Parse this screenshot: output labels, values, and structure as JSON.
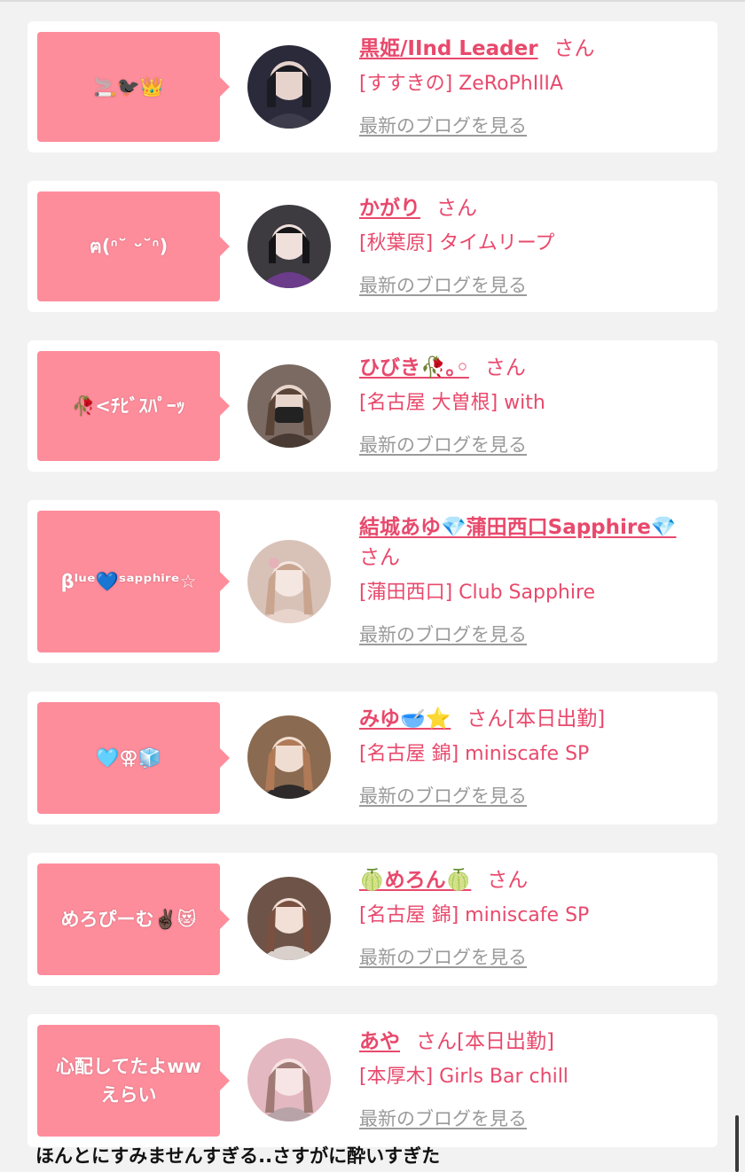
{
  "cards": [
    {
      "message": "🚬🐦‍⬛👑",
      "name": "黒姫/IInd Leader",
      "suffix": "さん",
      "badge": "",
      "shop": "[すすきの] ZeRoPhIlIA",
      "blog_link": "最新のブログを見る",
      "avatar_color": "#2a2a3a"
    },
    {
      "message": "ฅ(ᐢ˘ ᵕ˘ᐢ)",
      "name": "かがり",
      "suffix": "さん",
      "badge": "",
      "shop": "[秋葉原] タイムリープ",
      "blog_link": "最新のブログを見る",
      "avatar_color": "#5b3a6e"
    },
    {
      "message": "🥀<ﾁﾋﾞｽﾊﾟｰｯ",
      "name": "ひびき🥀｡◦",
      "suffix": "さん",
      "badge": "",
      "shop": "[名古屋 大曽根] with",
      "blog_link": "最新のブログを見る",
      "avatar_color": "#6b5a52"
    },
    {
      "message": "βˡᵘᵉ💙ˢᵃᵖᵖʰⁱʳᵉ☆",
      "name": "結城あゆ💎蒲田西口Sapphire💎",
      "suffix": "さん",
      "badge": "",
      "shop": "[蒲田西口] Club Sapphire",
      "blog_link": "最新のブログを見る",
      "avatar_color": "#d8c2b8"
    },
    {
      "message": "🩵⚢🧊",
      "name": "みゆ🥣⭐️",
      "suffix": "さん",
      "badge": "[本日出勤]",
      "shop": "[名古屋 錦] miniscafe SP",
      "blog_link": "最新のブログを見る",
      "avatar_color": "#8a6a50"
    },
    {
      "message": "めろぴーむ✌🏿😻",
      "name": "🍈めろん🍈",
      "suffix": "さん",
      "badge": "",
      "shop": "[名古屋 錦] miniscafe SP",
      "blog_link": "最新のブログを見る",
      "avatar_color": "#6e5448"
    },
    {
      "message": "心配してたよww\nえらい",
      "name": "あや",
      "suffix": "さん",
      "badge": "[本日出勤]",
      "shop": "[本厚木] Girls Bar chill",
      "blog_link": "最新のブログを見る",
      "avatar_color": "#e3b8c0"
    }
  ],
  "caption": "ほんとにすみませんすぎる..さすがに酔いすぎた",
  "colors": {
    "bubble": "#fe8d9c",
    "accent": "#e8496c",
    "link_gray": "#9a9a9a",
    "background": "#f2f2f2"
  }
}
